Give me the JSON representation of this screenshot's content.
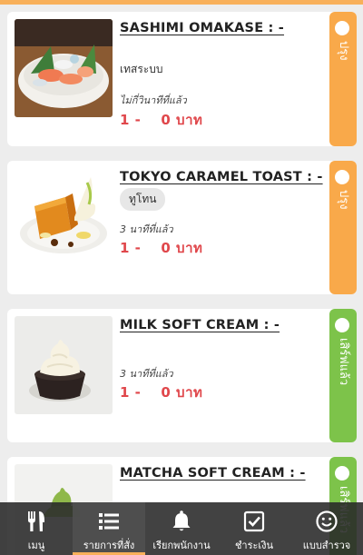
{
  "orders": [
    {
      "name": "SASHIMI OMAKASE : -",
      "option": "เทสระบบ",
      "ordered_ago": "ไม่กี่วินาทีที่แล้ว",
      "quantity": "1 -",
      "price": "0 บาท",
      "status": "ปรุง",
      "status_color": "#f9a94a",
      "image": "sashimi-platter"
    },
    {
      "name": "TOKYO CARAMEL TOAST : -",
      "option": "ทูโทน",
      "ordered_ago": "3 นาทีที่แล้ว",
      "quantity": "1 -",
      "price": "0 บาท",
      "status": "ปรุง",
      "status_color": "#f9a94a",
      "image": "caramel-toast"
    },
    {
      "name": "MILK SOFT CREAM : -",
      "ordered_ago": "3 นาทีที่แล้ว",
      "quantity": "1 -",
      "price": "0 บาท",
      "status": "เสิร์ฟแล้ว",
      "status_color": "#7dc34a",
      "image": "milk-soft-cream"
    },
    {
      "name": "MATCHA SOFT CREAM : -",
      "status": "เสิร์ฟแล้ว",
      "status_color": "#7dc34a",
      "image": "matcha-soft-cream"
    }
  ],
  "bottom_nav": {
    "items": [
      {
        "label": "เมนู",
        "icon": "cutlery-icon"
      },
      {
        "label": "รายการที่สั่ง",
        "icon": "list-icon",
        "active": true
      },
      {
        "label": "เรียกพนักงาน",
        "icon": "bell-icon"
      },
      {
        "label": "ชำระเงิน",
        "icon": "checkbox-icon"
      },
      {
        "label": "แบบสำรวจ",
        "icon": "smiley-icon"
      }
    ]
  },
  "colors": {
    "accent": "#f8b05a",
    "price": "#e0474b",
    "cooking": "#f9a94a",
    "served": "#7dc34a"
  }
}
